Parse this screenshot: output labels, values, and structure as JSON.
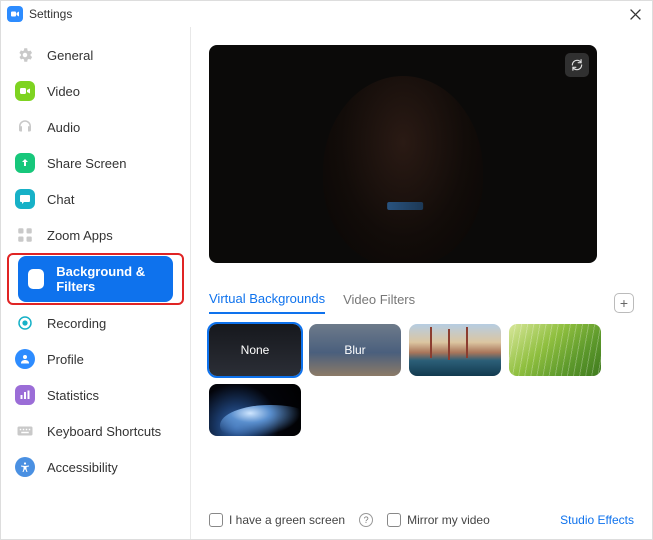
{
  "titlebar": {
    "title": "Settings"
  },
  "sidebar": {
    "items": [
      {
        "label": "General"
      },
      {
        "label": "Video"
      },
      {
        "label": "Audio"
      },
      {
        "label": "Share Screen"
      },
      {
        "label": "Chat"
      },
      {
        "label": "Zoom Apps"
      },
      {
        "label": "Background & Filters"
      },
      {
        "label": "Recording"
      },
      {
        "label": "Profile"
      },
      {
        "label": "Statistics"
      },
      {
        "label": "Keyboard Shortcuts"
      },
      {
        "label": "Accessibility"
      }
    ]
  },
  "tabs": {
    "virtual_backgrounds": "Virtual Backgrounds",
    "video_filters": "Video Filters"
  },
  "backgrounds": {
    "none_label": "None",
    "blur_label": "Blur"
  },
  "bottom": {
    "green_screen": "I have a green screen",
    "mirror": "Mirror my video",
    "studio_effects": "Studio Effects"
  },
  "colors": {
    "accent": "#0e72ed",
    "highlight_box": "#e02424"
  }
}
